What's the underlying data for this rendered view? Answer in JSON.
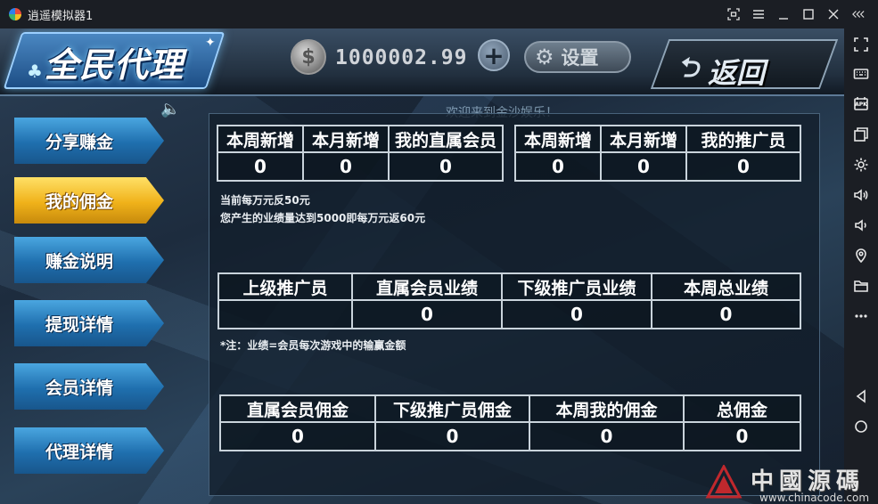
{
  "window": {
    "title": "逍遥模拟器1",
    "controls": [
      "shrink-icon",
      "menu-icon",
      "minimize-icon",
      "maximize-icon",
      "close-icon",
      "collapse-icon"
    ]
  },
  "sidebar": {
    "icons": [
      "fullscreen-icon",
      "keyboard-icon",
      "apk-install-icon",
      "multi-window-icon",
      "settings-icon",
      "volume-up-icon",
      "volume-down-icon",
      "location-icon",
      "folder-icon",
      "more-icon",
      "back-icon",
      "home-icon"
    ],
    "apk_label": "APK"
  },
  "header": {
    "title": "全民代理",
    "coin_symbol": "$",
    "coins": "1000002.99",
    "add_label": "+",
    "settings_label": "设置",
    "back_label": "返回",
    "marquee": "欢迎来到金沙娱乐！"
  },
  "menu": [
    {
      "label": "分享赚金",
      "active": false
    },
    {
      "label": "我的佣金",
      "active": true
    },
    {
      "label": "赚金说明",
      "active": false
    },
    {
      "label": "提现详情",
      "active": false
    },
    {
      "label": "会员详情",
      "active": false
    },
    {
      "label": "代理详情",
      "active": false
    }
  ],
  "table1": {
    "headers": [
      "本周新增",
      "本月新增",
      "我的直属会员"
    ],
    "values": [
      "0",
      "0",
      "0"
    ]
  },
  "table2": {
    "headers": [
      "本周新增",
      "本月新增",
      "我的推广员"
    ],
    "values": [
      "0",
      "0",
      "0"
    ]
  },
  "notes": {
    "rate_line1": "当前每万元反50元",
    "rate_line2": "您产生的业绩量达到5000即每万元返60元",
    "performance_note": "*注：业绩=会员每次游戏中的输赢金额"
  },
  "table3": {
    "headers": [
      "上级推广员",
      "直属会员业绩",
      "下级推广员业绩",
      "本周总业绩"
    ],
    "values": [
      "",
      "0",
      "0",
      "0"
    ]
  },
  "table4": {
    "headers": [
      "直属会员佣金",
      "下级推广员佣金",
      "本周我的佣金",
      "总佣金"
    ],
    "values": [
      "0",
      "0",
      "0",
      "0"
    ]
  },
  "watermark": {
    "text": "中國源碼",
    "url": "www.chinacode.com"
  }
}
